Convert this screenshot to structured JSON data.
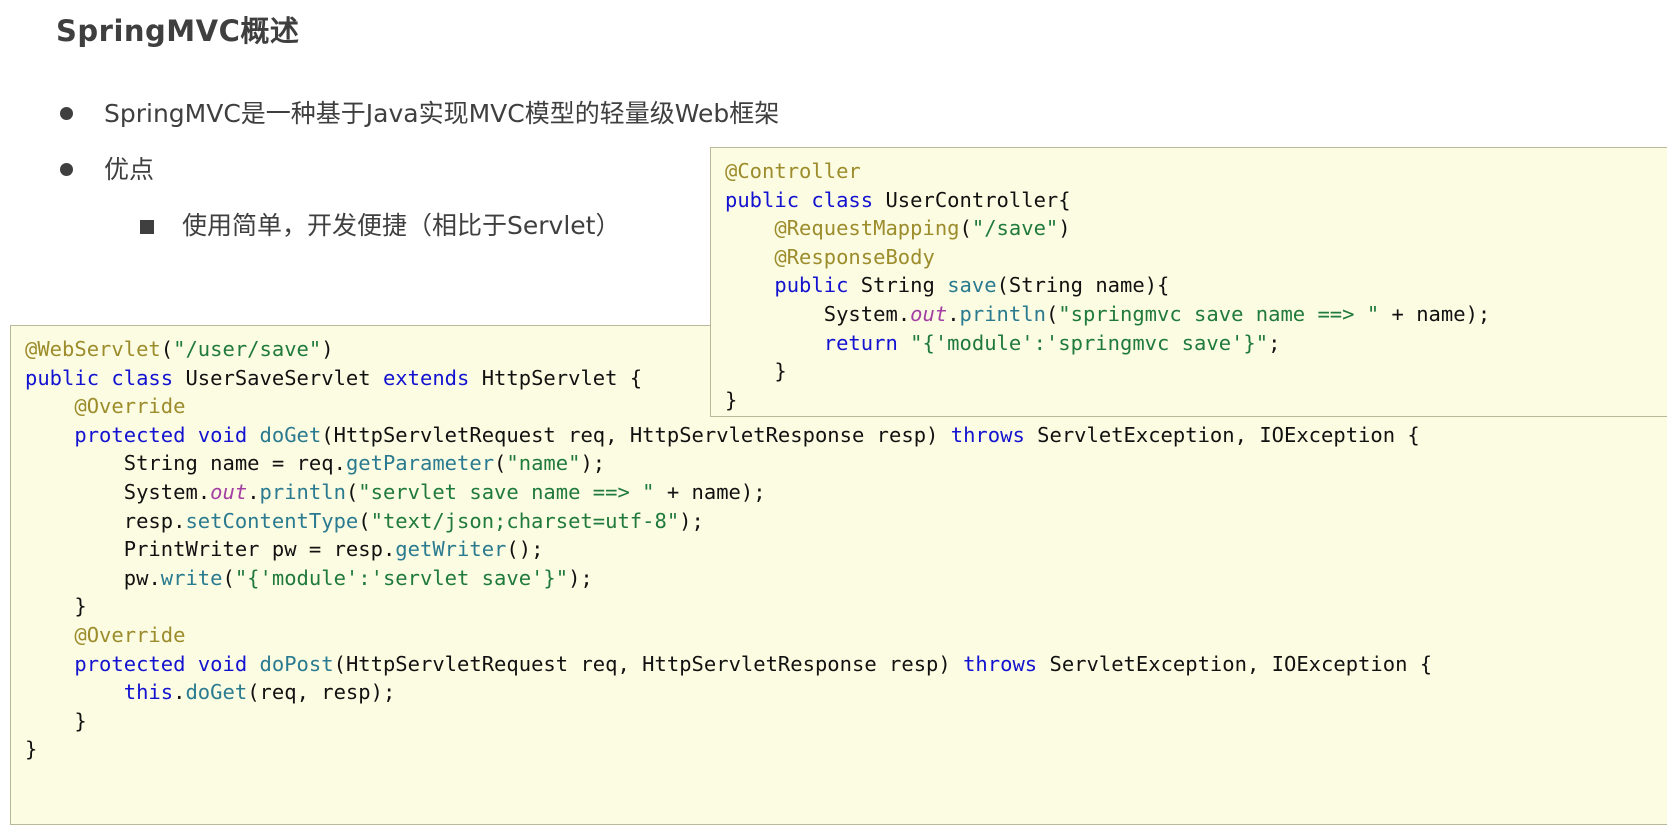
{
  "slide": {
    "title": "SpringMVC概述",
    "bullets": [
      {
        "level": 1,
        "marker": "disc",
        "text": "SpringMVC是一种基于Java实现MVC模型的轻量级Web框架"
      },
      {
        "level": 1,
        "marker": "disc",
        "text": "优点"
      },
      {
        "level": 2,
        "marker": "square",
        "text": "使用简单，开发便捷（相比于Servlet）"
      }
    ]
  },
  "code_blocks": {
    "controller": {
      "language": "java",
      "lines": [
        "@Controller",
        "public class UserController{",
        "    @RequestMapping(\"/save\")",
        "    @ResponseBody",
        "    public String save(String name){",
        "        System.out.println(\"springmvc save name ==> \" + name);",
        "        return \"{'module':'springmvc save'}\";",
        "    }",
        "}"
      ]
    },
    "servlet": {
      "language": "java",
      "lines": [
        "@WebServlet(\"/user/save\")",
        "public class UserSaveServlet extends HttpServlet {",
        "    @Override",
        "    protected void doGet(HttpServletRequest req, HttpServletResponse resp) throws ServletException, IOException {",
        "        String name = req.getParameter(\"name\");",
        "        System.out.println(\"servlet save name ==> \" + name);",
        "        resp.setContentType(\"text/json;charset=utf-8\");",
        "        PrintWriter pw = resp.getWriter();",
        "        pw.write(\"{'module':'servlet save'}\");",
        "    }",
        "    @Override",
        "    protected void doPost(HttpServletRequest req, HttpServletResponse resp) throws ServletException, IOException {",
        "        this.doGet(req, resp);",
        "    }",
        "}"
      ]
    }
  },
  "colors": {
    "background": "#ffffff",
    "text": "#3f3f3f",
    "code_background": "#fcfce2",
    "code_border": "#b9b99a",
    "annotation": "#9c8c2c",
    "keyword": "#1212d0",
    "method": "#2a7a90",
    "string": "#1f7a3c",
    "field_italic": "#a33fa3",
    "code_text": "#111111"
  }
}
